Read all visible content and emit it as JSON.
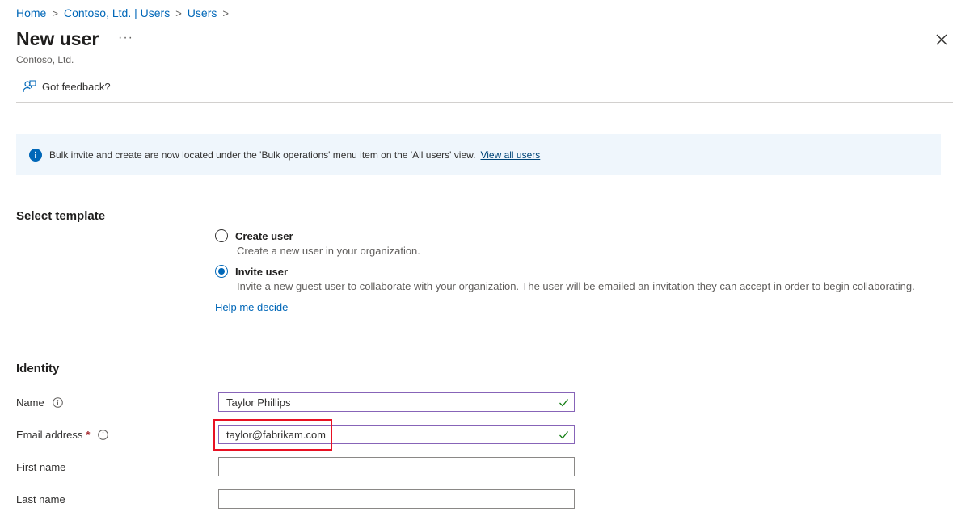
{
  "breadcrumb": {
    "items": [
      "Home",
      "Contoso, Ltd. | Users",
      "Users"
    ],
    "separator": ">"
  },
  "header": {
    "title": "New user",
    "more": "···",
    "subtitle": "Contoso, Ltd."
  },
  "toolbar": {
    "feedback_label": "Got feedback?"
  },
  "banner": {
    "message": "Bulk invite and create are now located under the 'Bulk operations' menu item on the 'All users' view.",
    "link": "View all users"
  },
  "template": {
    "heading": "Select template",
    "options": [
      {
        "label": "Create user",
        "description": "Create a new user in your organization.",
        "selected": false
      },
      {
        "label": "Invite user",
        "description": "Invite a new guest user to collaborate with your organization. The user will be emailed an invitation they can accept in order to begin collaborating.",
        "selected": true
      }
    ],
    "help_link": "Help me decide"
  },
  "identity": {
    "heading": "Identity",
    "fields": {
      "name": {
        "label": "Name",
        "value": "Taylor Phillips"
      },
      "email": {
        "label": "Email address",
        "required_mark": "*",
        "value": "taylor@fabrikam.com"
      },
      "first_name": {
        "label": "First name",
        "value": ""
      },
      "last_name": {
        "label": "Last name",
        "value": ""
      }
    }
  },
  "icons": [
    "chevron-right-icon",
    "more-icon",
    "close-icon",
    "feedback-icon",
    "info-icon",
    "checkmark-icon"
  ],
  "colors": {
    "accent": "#0067b8",
    "banner_bg": "#eff6fc",
    "valid_border": "#8764b8",
    "valid_check": "#107c10",
    "highlight": "#e81123",
    "required": "#a4262c"
  }
}
